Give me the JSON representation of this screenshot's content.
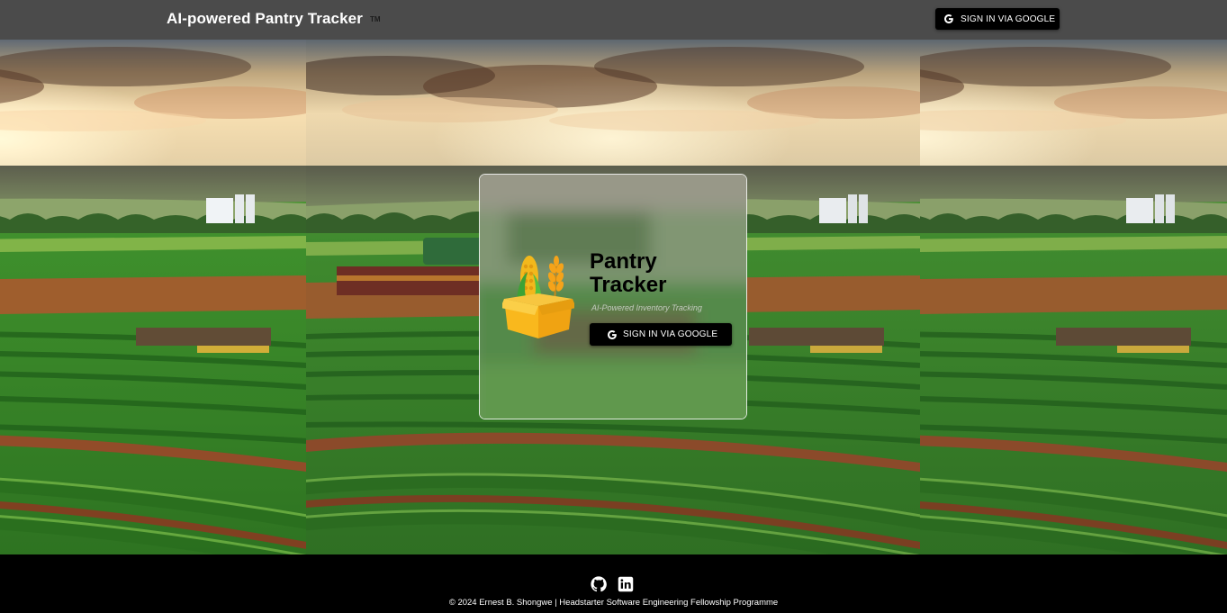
{
  "header": {
    "brand": "AI-powered Pantry Tracker",
    "brand_mark": "TM",
    "signin_label": "SIGN IN VIA GOOGLE"
  },
  "card": {
    "title": "Pantry Tracker",
    "subtitle": "AI-Powered Inventory Tracking",
    "signin_label": "SIGN IN VIA GOOGLE"
  },
  "footer": {
    "copyright": "© 2024 Ernest B. Shongwe | Headstarter Software Engineering Fellowship Programme"
  },
  "icons": {
    "google": "google-g-icon",
    "logo": "pantry-box-logo",
    "github": "github-icon",
    "linkedin": "linkedin-icon"
  },
  "colors": {
    "header_bg": "#4b4b4b",
    "button_bg": "#000000",
    "footer_bg": "#000000",
    "field_green": "#3f8a2e",
    "sky": "#e8c99a"
  }
}
